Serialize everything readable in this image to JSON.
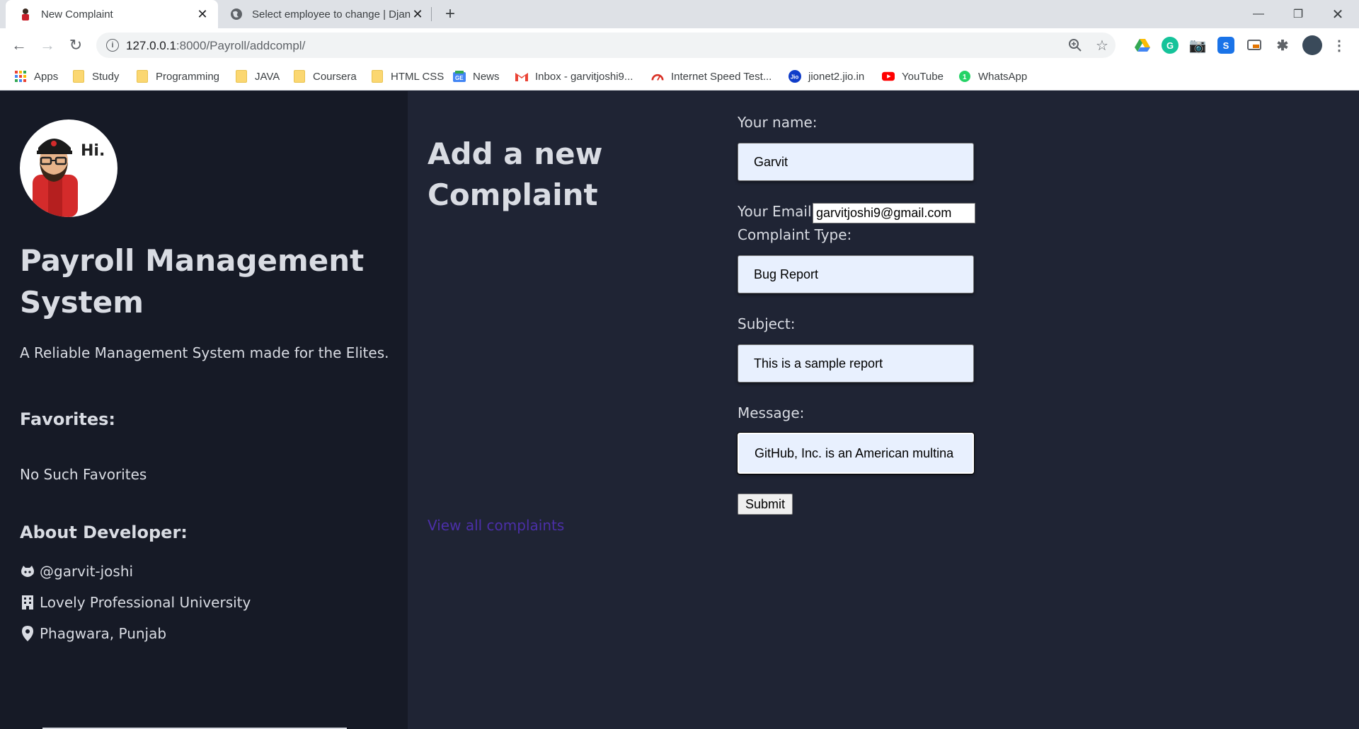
{
  "browser": {
    "tabs": [
      {
        "title": "New Complaint",
        "active": true
      },
      {
        "title": "Select employee to change | Djan",
        "active": false
      }
    ],
    "url_host": "127.0.0.1",
    "url_path": ":8000/Payroll/addcompl/",
    "bookmarks": [
      {
        "label": "Apps",
        "icon": "apps-grid-icon"
      },
      {
        "label": "Study",
        "icon": "folder-icon"
      },
      {
        "label": "Programming",
        "icon": "folder-icon"
      },
      {
        "label": "JAVA",
        "icon": "folder-icon"
      },
      {
        "label": "Coursera",
        "icon": "folder-icon"
      },
      {
        "label": "HTML CSS",
        "icon": "folder-icon"
      },
      {
        "label": "News",
        "icon": "google-news-icon"
      },
      {
        "label": "Inbox - garvitjoshi9...",
        "icon": "gmail-icon"
      },
      {
        "label": "Internet Speed Test...",
        "icon": "speedometer-icon"
      },
      {
        "label": "jionet2.jio.in",
        "icon": "jio-icon"
      },
      {
        "label": "YouTube",
        "icon": "youtube-icon"
      },
      {
        "label": "WhatsApp",
        "icon": "whatsapp-icon"
      }
    ]
  },
  "sidebar": {
    "greeting": "Hi.",
    "title": "Payroll Management System",
    "tagline": "A Reliable Management System made for the Elites.",
    "favorites_heading": "Favorites:",
    "favorites_empty": "No Such Favorites",
    "about_heading": "About Developer:",
    "github": "@garvit-joshi",
    "university": "Lovely Professional University",
    "location": "Phagwara, Punjab"
  },
  "main": {
    "heading": "Add a new Complaint",
    "view_all_link": "View all complaints"
  },
  "form": {
    "name_label": "Your name:",
    "name_value": "Garvit",
    "email_label": "Your Email:",
    "email_value": "garvitjoshi9@gmail.com",
    "type_label": "Complaint Type:",
    "type_value": "Bug Report",
    "subject_label": "Subject:",
    "subject_value": "This is a sample report",
    "message_label": "Message:",
    "message_value": "GitHub, Inc. is an American multina",
    "submit_label": "Submit"
  },
  "colors": {
    "sidebar_bg": "#161a26",
    "main_bg": "#1f2434",
    "text": "#d9dce3",
    "link": "#4b2fa8",
    "input_bg": "#e8f0fe"
  }
}
